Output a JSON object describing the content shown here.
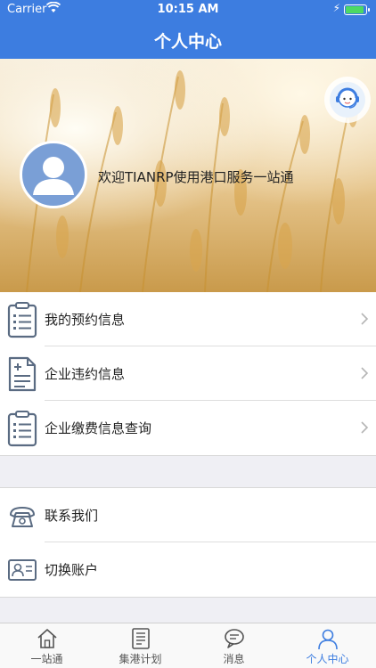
{
  "status_bar": {
    "carrier": "Carrier",
    "time": "10:15 AM"
  },
  "navbar": {
    "title": "个人中心"
  },
  "profile": {
    "welcome_text": "欢迎TIANRP使用港口服务一站通"
  },
  "menu_group_1": [
    {
      "label": "我的预约信息",
      "icon": "clipboard-list-icon"
    },
    {
      "label": "企业违约信息",
      "icon": "document-plus-icon"
    },
    {
      "label": "企业缴费信息查询",
      "icon": "clipboard-list-icon"
    }
  ],
  "menu_group_2": [
    {
      "label": "联系我们",
      "icon": "telephone-icon"
    },
    {
      "label": "切换账户",
      "icon": "id-card-icon"
    }
  ],
  "tabs": [
    {
      "label": "一站通",
      "icon": "home-icon"
    },
    {
      "label": "集港计划",
      "icon": "list-document-icon"
    },
    {
      "label": "消息",
      "icon": "chat-bubble-icon"
    },
    {
      "label": "个人中心",
      "icon": "user-icon",
      "active": true
    }
  ],
  "colors": {
    "primary": "#3d7de0",
    "battery": "#4cd964"
  }
}
